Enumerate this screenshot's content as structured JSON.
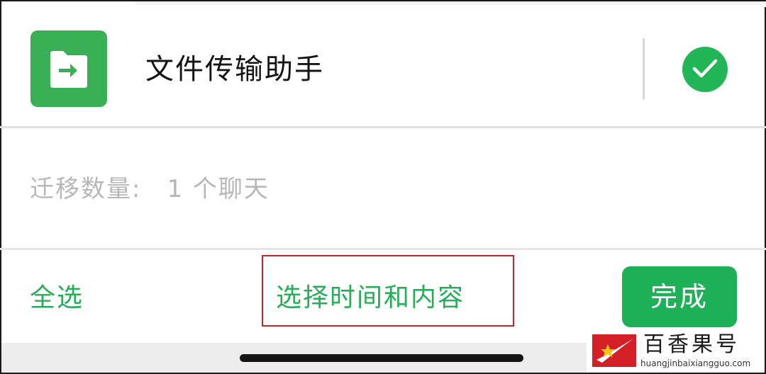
{
  "chat": {
    "name": "文件传输助手",
    "icon": "folder-arrow-icon",
    "selected_icon": "check-circle-icon"
  },
  "migrate": {
    "label": "迁移数量:",
    "value": "1 个聊天"
  },
  "actions": {
    "select_all": "全选",
    "select_time_content": "选择时间和内容",
    "done": "完成"
  },
  "watermark": {
    "name": "百香果号",
    "url": "huangjinbaixiangguo.com"
  },
  "colors": {
    "accent_green": "#25ad57",
    "highlight_red": "#c8222a"
  }
}
